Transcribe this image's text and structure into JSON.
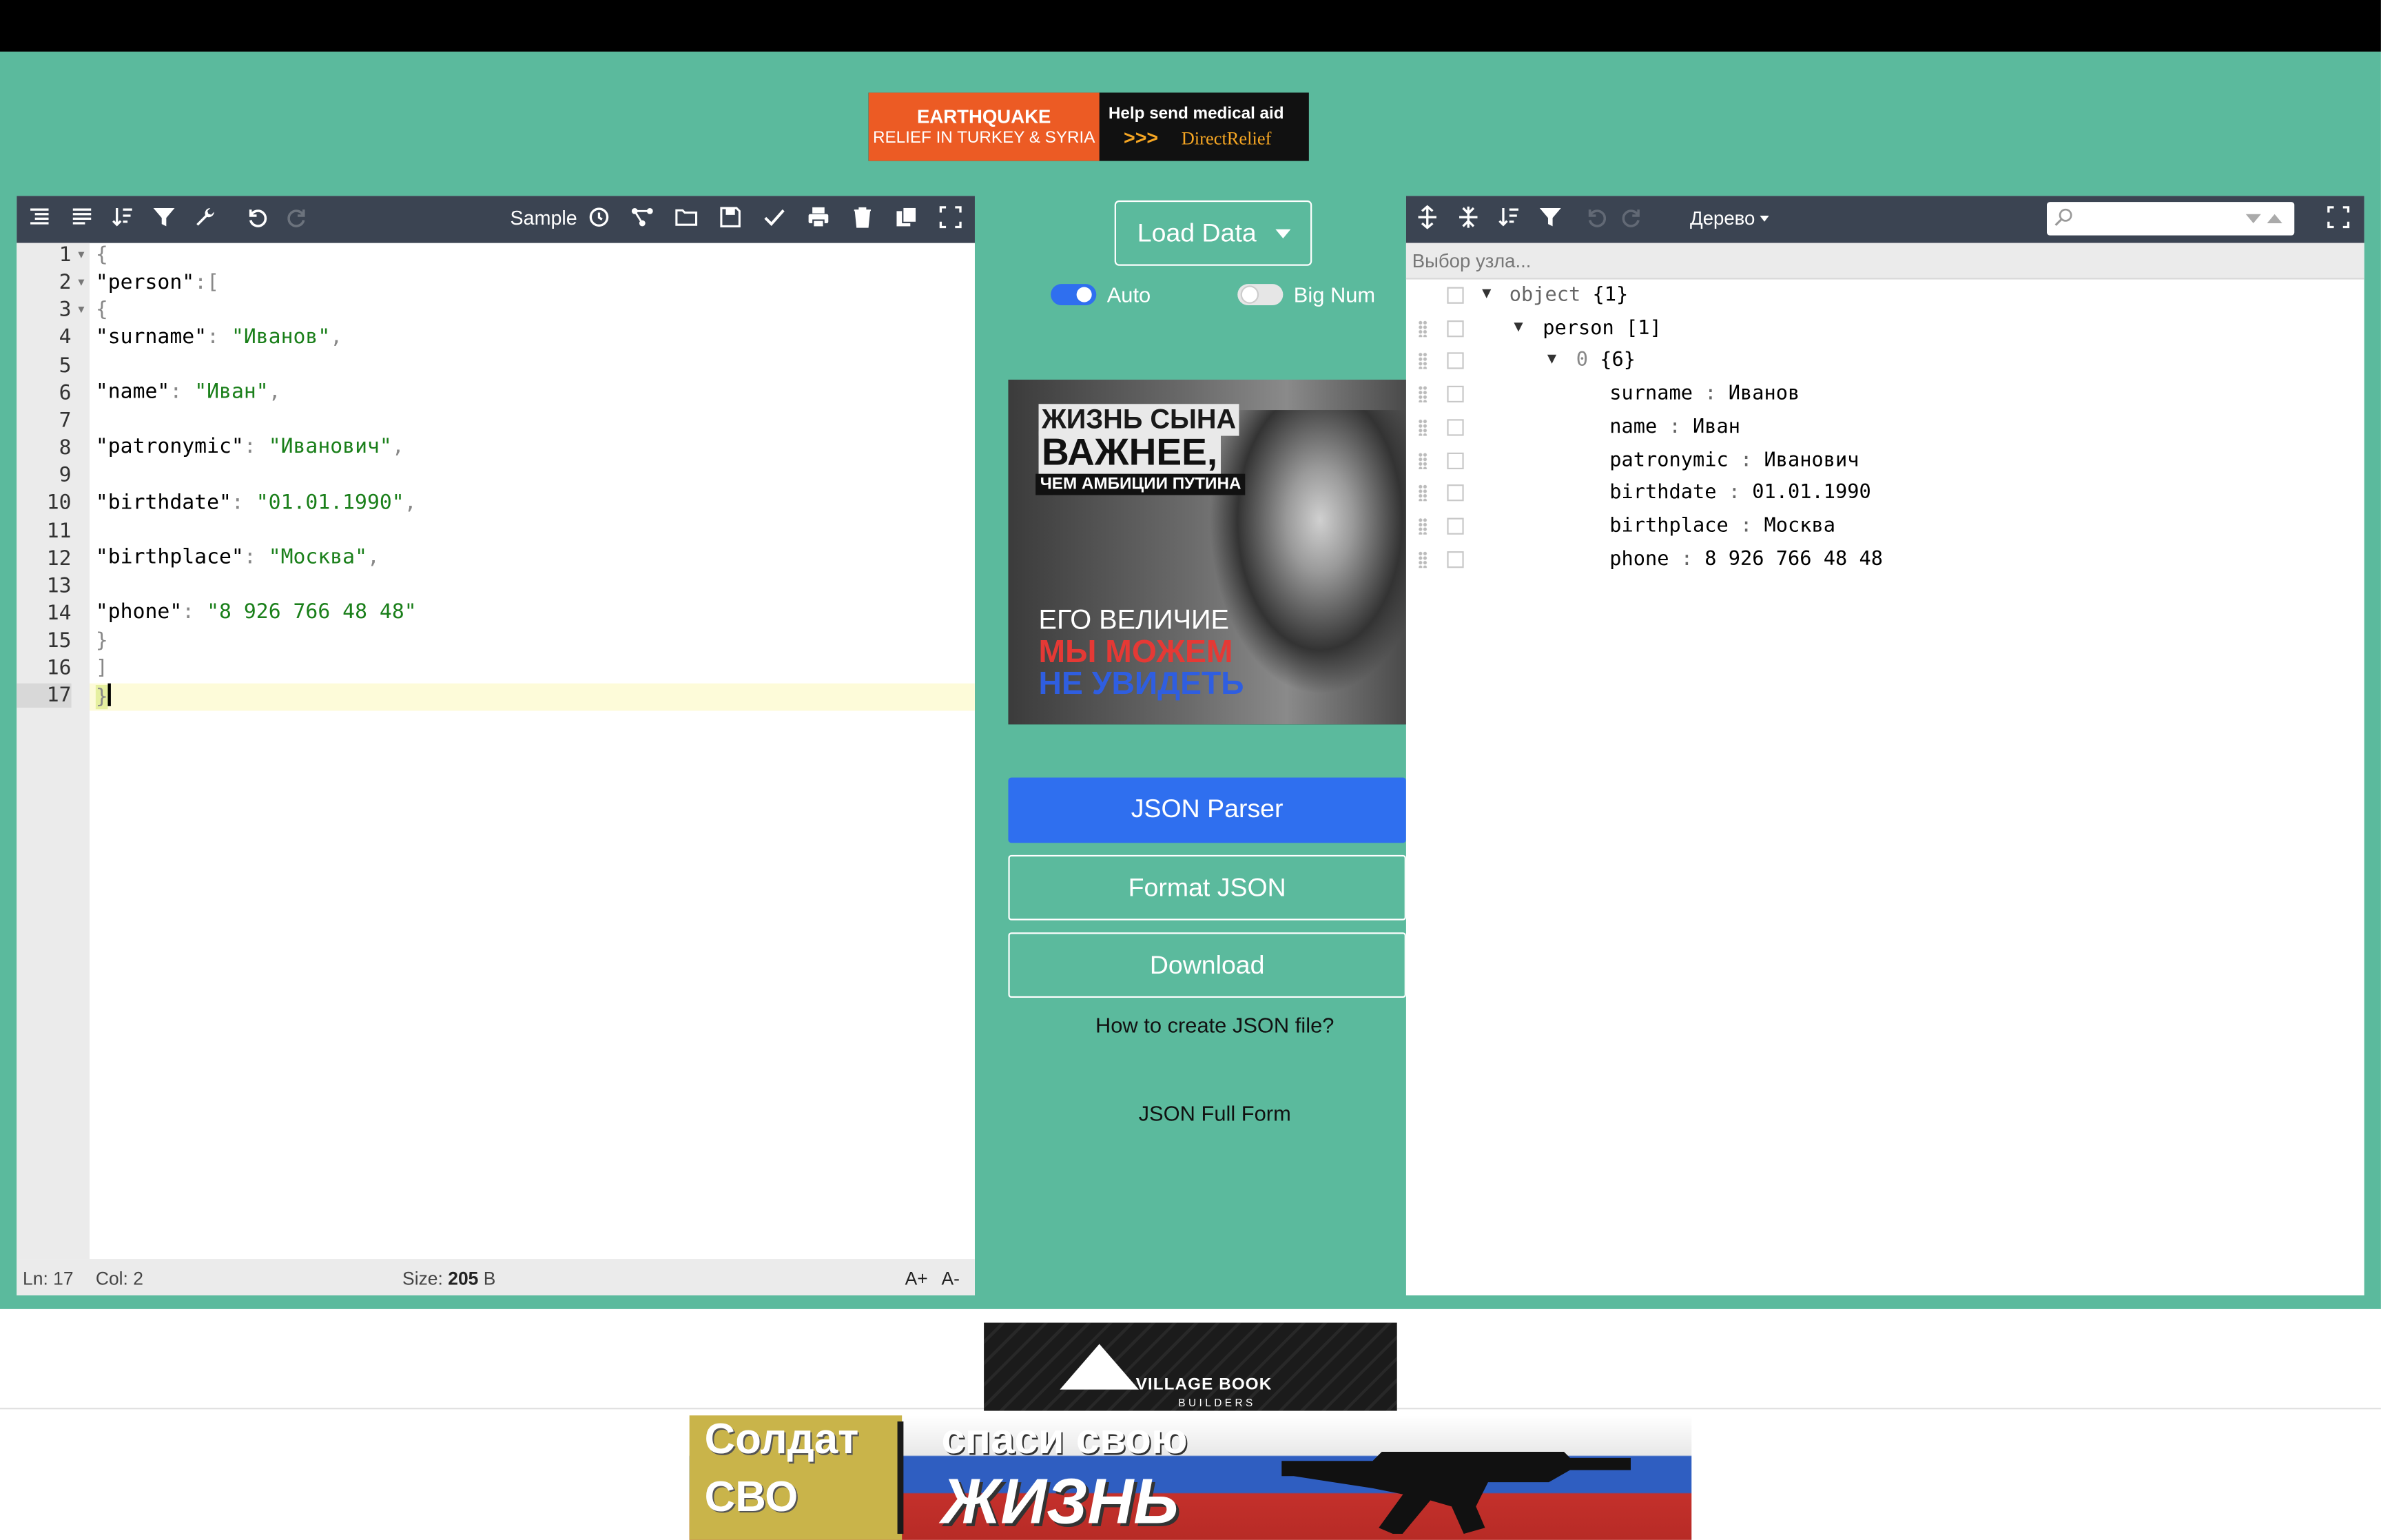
{
  "ads": {
    "earthquake": {
      "line1": "EARTHQUAKE",
      "line2": "RELIEF IN TURKEY & SYRIA",
      "right_title": "Help send medical aid",
      "arrows": ">>>",
      "brand": "DirectRelief"
    },
    "propaganda": {
      "line1": "ЖИЗНЬ СЫНА",
      "line2": "ВАЖНЕЕ,",
      "line3": "ЧЕМ АМБИЦИИ ПУТИНА",
      "line4": "ЕГО ВЕЛИЧИЕ",
      "line5": "МЫ МОЖЕМ",
      "line6": "НЕ УВИДЕТЬ"
    },
    "village": {
      "name": "VILLAGE BOOK",
      "sub": "BUILDERS"
    },
    "svo": {
      "left1": "Солдат",
      "left2": "СВО",
      "right1": "спаси свою",
      "right2": "ЖИЗНЬ"
    }
  },
  "editor": {
    "sample_label": "Sample",
    "lines": [
      {
        "n": "1",
        "fold": true
      },
      {
        "n": "2",
        "fold": true
      },
      {
        "n": "3",
        "fold": true
      },
      {
        "n": "4"
      },
      {
        "n": "5"
      },
      {
        "n": "6"
      },
      {
        "n": "7"
      },
      {
        "n": "8"
      },
      {
        "n": "9"
      },
      {
        "n": "10"
      },
      {
        "n": "11"
      },
      {
        "n": "12"
      },
      {
        "n": "13"
      },
      {
        "n": "14"
      },
      {
        "n": "15"
      },
      {
        "n": "16"
      },
      {
        "n": "17"
      }
    ],
    "code": {
      "l1": "{",
      "l2_key": "\"person\"",
      "l2_rest": ":[",
      "l3": "{",
      "l4_key": "\"surname\"",
      "l4_val": "\"Иванов\"",
      "l6_key": "\"name\"",
      "l6_val": "\"Иван\"",
      "l8_key": "\"patronymic\"",
      "l8_val": "\"Иванович\"",
      "l10_key": "\"birthdate\"",
      "l10_val": "\"01.01.1990\"",
      "l12_key": "\"birthplace\"",
      "l12_val": "\"Москва\"",
      "l14_key": "\"phone\"",
      "l14_val": "\"8 926 766 48 48\"",
      "l15": "}",
      "l16": "]",
      "l17": "}"
    },
    "status": {
      "ln": "Ln: 17",
      "col": "Col: 2",
      "size_label": "Size:",
      "size_value": "205",
      "size_unit": "B",
      "font_plus": "A+",
      "font_minus": "A-"
    }
  },
  "middle": {
    "load_data": "Load Data",
    "auto_label": "Auto",
    "auto_on": true,
    "bignum_label": "Big Num",
    "bignum_on": false,
    "json_parser": "JSON Parser",
    "format_json": "Format JSON",
    "download": "Download",
    "how_to": "How to create JSON file?",
    "full_form": "JSON Full Form"
  },
  "tree": {
    "mode": "Дерево",
    "breadcrumb_placeholder": "Выбор узла...",
    "nodes": {
      "root_key": "object",
      "root_count": "{1}",
      "person_key": "person",
      "person_count": "[1]",
      "idx_key": "0",
      "idx_count": "{6}"
    },
    "fields": [
      {
        "key": "surname",
        "value": "Иванов"
      },
      {
        "key": "name",
        "value": "Иван"
      },
      {
        "key": "patronymic",
        "value": "Иванович"
      },
      {
        "key": "birthdate",
        "value": "01.01.1990"
      },
      {
        "key": "birthplace",
        "value": "Москва"
      },
      {
        "key": "phone",
        "value": "8 926 766 48 48"
      }
    ],
    "sep": ":"
  },
  "colors": {
    "page_green": "#5bba9d",
    "toolbar": "#3b4452",
    "primary": "#2f6fef",
    "toggle_on": "#2f6fef",
    "toggle_off": "#e6e6e6"
  }
}
